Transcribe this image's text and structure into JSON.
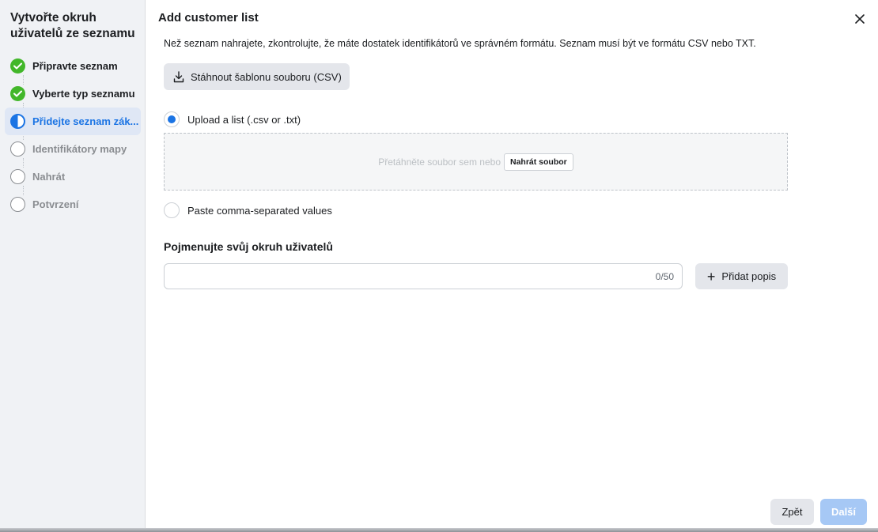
{
  "sidebar": {
    "title": "Vytvořte okruh uživatelů ze seznamu",
    "steps": [
      {
        "label": "Připravte seznam",
        "state": "done"
      },
      {
        "label": "Vyberte typ seznamu",
        "state": "done"
      },
      {
        "label": "Přidejte seznam zák...",
        "state": "current"
      },
      {
        "label": "Identifikátory mapy",
        "state": "todo"
      },
      {
        "label": "Nahrát",
        "state": "todo"
      },
      {
        "label": "Potvrzení",
        "state": "todo"
      }
    ]
  },
  "modal": {
    "title": "Add customer list",
    "close_icon": "close-icon",
    "description": "Než seznam nahrajete, zkontrolujte, že máte dostatek identifikátorů ve správném formátu. Seznam musí být ve formátu CSV nebo TXT.",
    "download_button": "Stáhnout šablonu souboru (CSV)",
    "upload_option": {
      "label": "Upload a list (.csv or .txt)",
      "selected": true
    },
    "dropzone": {
      "text": "Přetáhněte soubor sem nebo",
      "button": "Nahrát soubor"
    },
    "paste_option": {
      "label": "Paste comma-separated values",
      "selected": false
    },
    "name_section": {
      "title": "Pojmenujte svůj okruh uživatelů",
      "input_value": "",
      "counter": "0/50",
      "add_description_button": "Přidat popis",
      "add_description_icon": "+"
    }
  },
  "footer": {
    "back_button": "Zpět",
    "next_button": "Další"
  },
  "colors": {
    "accent": "#1b74e4",
    "done": "#42b72a",
    "next_disabled": "#a6c8f5"
  }
}
